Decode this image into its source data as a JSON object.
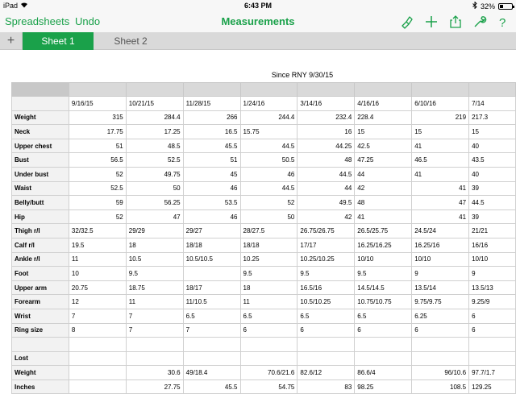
{
  "status": {
    "device": "iPad",
    "time": "6:43 PM",
    "battery": "32%",
    "battery_level": 0.32
  },
  "nav": {
    "left_button": "Spreadsheets",
    "undo_button": "Undo",
    "title": "Measurements"
  },
  "tabs": [
    {
      "label": "Sheet 1",
      "active": true
    },
    {
      "label": "Sheet 2",
      "active": false
    }
  ],
  "sheet": {
    "title": "Since RNY 9/30/15",
    "columns": [
      "9/16/15",
      "10/21/15",
      "11/28/15",
      "1/24/16",
      "3/14/16",
      "4/16/16",
      "6/10/16",
      "7/14"
    ],
    "rows": [
      {
        "label": "",
        "cells": [
          "9/16/15",
          "10/21/15",
          "11/28/15",
          "1/24/16",
          "3/14/16",
          "4/16/16",
          "6/10/16",
          "7/14"
        ],
        "align": [
          "l",
          "l",
          "l",
          "l",
          "l",
          "l",
          "l",
          "l"
        ]
      },
      {
        "label": "Weight",
        "cells": [
          "315",
          "284.4",
          "266",
          "244.4",
          "232.4",
          "228.4",
          "219",
          "217.3"
        ],
        "align": [
          "r",
          "r",
          "r",
          "r",
          "r",
          "l",
          "r",
          "l"
        ]
      },
      {
        "label": "Neck",
        "cells": [
          "17.75",
          "17.25",
          "16.5",
          "15.75",
          "16",
          "15",
          "15",
          "15"
        ],
        "align": [
          "r",
          "r",
          "r",
          "l",
          "r",
          "l",
          "l",
          "l"
        ]
      },
      {
        "label": "Upper chest",
        "cells": [
          "51",
          "48.5",
          "45.5",
          "44.5",
          "44.25",
          "42.5",
          "41",
          "40"
        ],
        "align": [
          "r",
          "r",
          "r",
          "r",
          "r",
          "l",
          "l",
          "l"
        ]
      },
      {
        "label": "Bust",
        "cells": [
          "56.5",
          "52.5",
          "51",
          "50.5",
          "48",
          "47.25",
          "46.5",
          "43.5"
        ],
        "align": [
          "r",
          "r",
          "r",
          "r",
          "r",
          "l",
          "l",
          "l"
        ]
      },
      {
        "label": "Under bust",
        "cells": [
          "52",
          "49.75",
          "45",
          "46",
          "44.5",
          "44",
          "41",
          "40"
        ],
        "align": [
          "r",
          "r",
          "r",
          "r",
          "r",
          "l",
          "l",
          "l"
        ]
      },
      {
        "label": "Waist",
        "cells": [
          "52.5",
          "50",
          "46",
          "44.5",
          "44",
          "42",
          "41",
          "39"
        ],
        "align": [
          "r",
          "r",
          "r",
          "r",
          "r",
          "l",
          "r",
          "l"
        ]
      },
      {
        "label": "Belly/butt",
        "cells": [
          "59",
          "56.25",
          "53.5",
          "52",
          "49.5",
          "48",
          "47",
          "44.5"
        ],
        "align": [
          "r",
          "r",
          "r",
          "r",
          "r",
          "l",
          "r",
          "l"
        ]
      },
      {
        "label": "Hip",
        "cells": [
          "52",
          "47",
          "46",
          "50",
          "42",
          "41",
          "41",
          "39"
        ],
        "align": [
          "r",
          "r",
          "r",
          "r",
          "r",
          "l",
          "r",
          "l"
        ]
      },
      {
        "label": "Thigh r/l",
        "cells": [
          "32/32.5",
          "29/29",
          "29/27",
          "28/27.5",
          "26.75/26.75",
          "26.5/25.75",
          "24.5/24",
          "21/21"
        ],
        "align": [
          "l",
          "l",
          "l",
          "l",
          "l",
          "l",
          "l",
          "l"
        ]
      },
      {
        "label": "Calf r/l",
        "cells": [
          "19.5",
          "18",
          "18/18",
          "18/18",
          "17/17",
          "16.25/16.25",
          "16.25/16",
          "16/16"
        ],
        "align": [
          "l",
          "l",
          "l",
          "l",
          "l",
          "l",
          "l",
          "l"
        ]
      },
      {
        "label": "Ankle r/l",
        "cells": [
          "11",
          "10.5",
          "10.5/10.5",
          "10.25",
          "10.25/10.25",
          "10/10",
          "10/10",
          "10/10"
        ],
        "align": [
          "l",
          "l",
          "l",
          "l",
          "l",
          "l",
          "l",
          "l"
        ]
      },
      {
        "label": "Foot",
        "cells": [
          "10",
          "9.5",
          "",
          "9.5",
          "9.5",
          "9.5",
          "9",
          "9"
        ],
        "align": [
          "l",
          "l",
          "l",
          "l",
          "l",
          "l",
          "l",
          "l"
        ]
      },
      {
        "label": "Upper arm",
        "cells": [
          "20.75",
          "18.75",
          "18/17",
          "18",
          "16.5/16",
          "14.5/14.5",
          "13.5/14",
          "13.5/13"
        ],
        "align": [
          "l",
          "l",
          "l",
          "l",
          "l",
          "l",
          "l",
          "l"
        ]
      },
      {
        "label": "Forearm",
        "cells": [
          "12",
          "11",
          "11/10.5",
          "11",
          "10.5/10.25",
          "10.75/10.75",
          "9.75/9.75",
          "9.25/9"
        ],
        "align": [
          "l",
          "l",
          "l",
          "l",
          "l",
          "l",
          "l",
          "l"
        ]
      },
      {
        "label": "Wrist",
        "cells": [
          "7",
          "7",
          "6.5",
          "6.5",
          "6.5",
          "6.5",
          "6.25",
          "6"
        ],
        "align": [
          "l",
          "l",
          "l",
          "l",
          "l",
          "l",
          "l",
          "l"
        ]
      },
      {
        "label": "Ring size",
        "cells": [
          "8",
          "7",
          "7",
          "6",
          "6",
          "6",
          "6",
          "6"
        ],
        "align": [
          "l",
          "l",
          "l",
          "l",
          "l",
          "l",
          "l",
          "l"
        ]
      },
      {
        "label": "",
        "cells": [
          "",
          "",
          "",
          "",
          "",
          "",
          "",
          ""
        ],
        "align": [
          "l",
          "l",
          "l",
          "l",
          "l",
          "l",
          "l",
          "l"
        ]
      },
      {
        "label": "Lost",
        "cells": [
          "",
          "",
          "",
          "",
          "",
          "",
          "",
          ""
        ],
        "align": [
          "l",
          "l",
          "l",
          "l",
          "l",
          "l",
          "l",
          "l"
        ]
      },
      {
        "label": "Weight",
        "cells": [
          "",
          "30.6",
          "49/18.4",
          "70.6/21.6",
          "82.6/12",
          "86.6/4",
          "96/10.6",
          "97.7/1.7"
        ],
        "align": [
          "l",
          "r",
          "l",
          "r",
          "l",
          "l",
          "r",
          "l"
        ]
      },
      {
        "label": "Inches",
        "cells": [
          "",
          "27.75",
          "45.5",
          "54.75",
          "83",
          "98.25",
          "108.5",
          "129.25"
        ],
        "align": [
          "l",
          "r",
          "r",
          "r",
          "r",
          "l",
          "r",
          "l"
        ]
      }
    ]
  }
}
